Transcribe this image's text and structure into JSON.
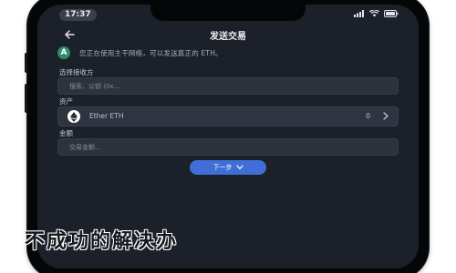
{
  "status_bar": {
    "time": "17:37"
  },
  "header": {
    "title": "发送交易"
  },
  "notice": {
    "icon": "ethereum-icon",
    "icon_letter": "A",
    "text": "您正在使用主干网络，可以发送真正的 ETH。"
  },
  "receiver": {
    "label": "选择接收方",
    "placeholder": "搜索、公钥 (0x…"
  },
  "asset": {
    "label": "资产",
    "name": "Ether  ETH",
    "balance": "0",
    "icon": "ether-logo-icon"
  },
  "amount": {
    "label": "金额",
    "placeholder": "交易金额..."
  },
  "next_button": {
    "label": "下一步"
  },
  "caption": {
    "text": "不成功的解决办"
  },
  "colors": {
    "screen_bg": "#1c2029",
    "input_bg": "#2d323d",
    "accent_blue": "#3f6fd6",
    "notice_green": "#2e8b6a"
  }
}
